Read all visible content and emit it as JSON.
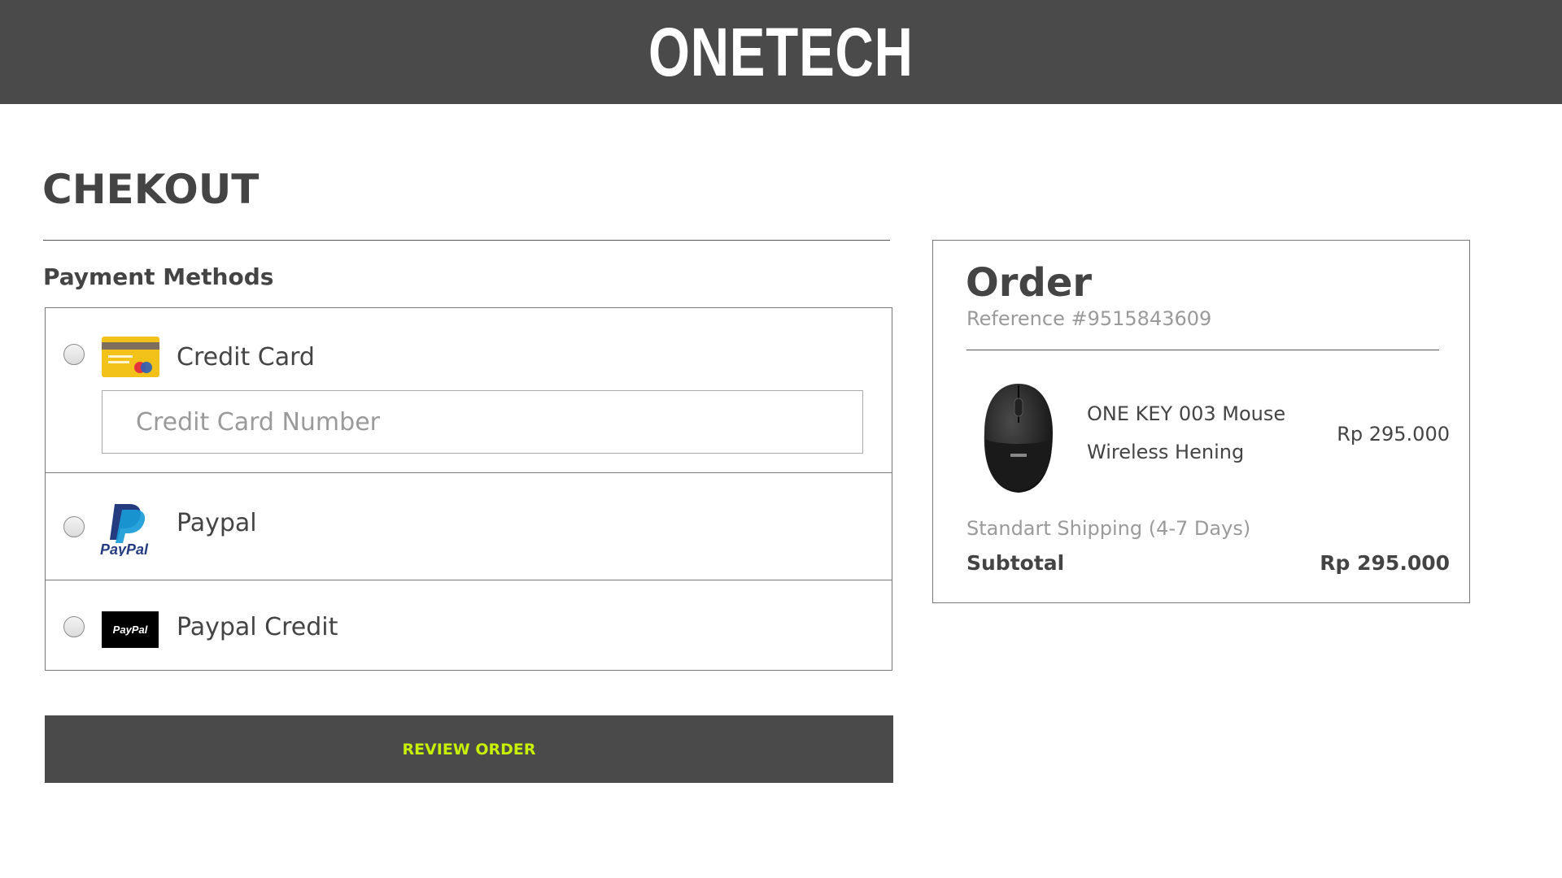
{
  "header": {
    "logo_text": "ONETECH"
  },
  "page": {
    "title": "CHEKOUT"
  },
  "payment": {
    "heading": "Payment Methods",
    "methods": [
      {
        "label": "Credit Card",
        "icon": "credit-card-icon",
        "selected": false
      },
      {
        "label": "Paypal",
        "icon": "paypal-logo-icon",
        "selected": false
      },
      {
        "label": "Paypal Credit",
        "icon": "paypal-credit-icon",
        "selected": false
      }
    ],
    "card_number": {
      "placeholder": "Credit Card Number",
      "value": ""
    },
    "paypal_logo_text": "PayPal",
    "paypal_credit_logo_text": "PayPal"
  },
  "review_button": {
    "label": "REVIEW ORDER"
  },
  "order": {
    "title": "Order",
    "reference": "Reference #9515843609",
    "item": {
      "name": "ONE KEY 003 Mouse Wireless Hening",
      "price": "Rp 295.000",
      "image": "wireless-mouse-image"
    },
    "shipping": "Standart Shipping (4-7 Days)",
    "subtotal_label": "Subtotal",
    "subtotal_value": "Rp 295.000"
  },
  "colors": {
    "header_bg": "#4a4a4a",
    "button_bg": "#4a4a4a",
    "button_text": "#c6f000",
    "text": "#444444",
    "muted_text": "#9a9a9a"
  }
}
